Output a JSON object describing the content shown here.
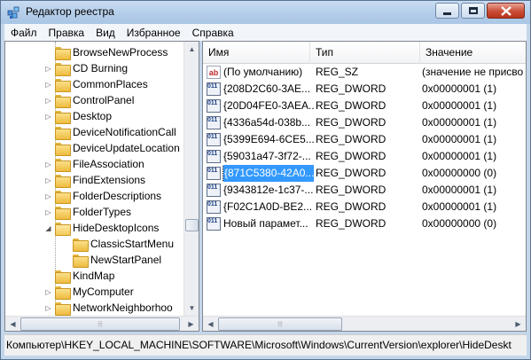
{
  "window": {
    "title": "Редактор реестра"
  },
  "menu": [
    "Файл",
    "Правка",
    "Вид",
    "Избранное",
    "Справка"
  ],
  "tree": {
    "items": [
      {
        "label": "BrowseNewProcess",
        "expandable": false,
        "level": 1
      },
      {
        "label": "CD Burning",
        "expandable": true,
        "level": 1
      },
      {
        "label": "CommonPlaces",
        "expandable": true,
        "level": 1
      },
      {
        "label": "ControlPanel",
        "expandable": true,
        "level": 1
      },
      {
        "label": "Desktop",
        "expandable": true,
        "level": 1
      },
      {
        "label": "DeviceNotificationCall",
        "expandable": false,
        "level": 1
      },
      {
        "label": "DeviceUpdateLocation",
        "expandable": false,
        "level": 1
      },
      {
        "label": "FileAssociation",
        "expandable": true,
        "level": 1
      },
      {
        "label": "FindExtensions",
        "expandable": true,
        "level": 1
      },
      {
        "label": "FolderDescriptions",
        "expandable": true,
        "level": 1
      },
      {
        "label": "FolderTypes",
        "expandable": true,
        "level": 1
      },
      {
        "label": "HideDesktopIcons",
        "expandable": true,
        "expanded": true,
        "level": 1
      },
      {
        "label": "ClassicStartMenu",
        "expandable": false,
        "level": 2
      },
      {
        "label": "NewStartPanel",
        "expandable": false,
        "level": 2
      },
      {
        "label": "KindMap",
        "expandable": false,
        "level": 1
      },
      {
        "label": "MyComputer",
        "expandable": true,
        "level": 1
      },
      {
        "label": "NetworkNeighborhoo",
        "expandable": true,
        "level": 1
      }
    ]
  },
  "list": {
    "columns": {
      "name": "Имя",
      "type": "Тип",
      "data": "Значение"
    },
    "rows": [
      {
        "name": "(По умолчанию)",
        "type": "REG_SZ",
        "data": "(значение не присво",
        "icon": "string-value-icon",
        "glyph": "ab"
      },
      {
        "name": "{208D2C60-3AE...",
        "type": "REG_DWORD",
        "data": "0x00000001 (1)",
        "icon": "dword-value-icon",
        "glyph": "011 110"
      },
      {
        "name": "{20D04FE0-3AEA...",
        "type": "REG_DWORD",
        "data": "0x00000001 (1)",
        "icon": "dword-value-icon",
        "glyph": "011 110"
      },
      {
        "name": "{4336a54d-038b...",
        "type": "REG_DWORD",
        "data": "0x00000001 (1)",
        "icon": "dword-value-icon",
        "glyph": "011 110"
      },
      {
        "name": "{5399E694-6CE5...",
        "type": "REG_DWORD",
        "data": "0x00000001 (1)",
        "icon": "dword-value-icon",
        "glyph": "011 110"
      },
      {
        "name": "{59031a47-3f72-...",
        "type": "REG_DWORD",
        "data": "0x00000001 (1)",
        "icon": "dword-value-icon",
        "glyph": "011 110"
      },
      {
        "name": "{871C5380-42A0...",
        "type": "REG_DWORD",
        "data": "0x00000000 (0)",
        "icon": "dword-value-icon",
        "glyph": "011 110",
        "selected": true
      },
      {
        "name": "{9343812e-1c37-...",
        "type": "REG_DWORD",
        "data": "0x00000001 (1)",
        "icon": "dword-value-icon",
        "glyph": "011 110"
      },
      {
        "name": "{F02C1A0D-BE2...",
        "type": "REG_DWORD",
        "data": "0x00000001 (1)",
        "icon": "dword-value-icon",
        "glyph": "011 110"
      },
      {
        "name": "Новый парамет...",
        "type": "REG_DWORD",
        "data": "0x00000000 (0)",
        "icon": "dword-value-icon",
        "glyph": "011 110"
      }
    ]
  },
  "status": {
    "path": "Компьютер\\HKEY_LOCAL_MACHINE\\SOFTWARE\\Microsoft\\Windows\\CurrentVersion\\explorer\\HideDeskt"
  },
  "icons": {
    "expand": "▷",
    "expanded": "◢",
    "arrow_up": "▲",
    "arrow_down": "▼",
    "arrow_left": "◀",
    "arrow_right": "▶",
    "grip": "⦙⦙⦙"
  },
  "colors": {
    "selection": "#3399ff",
    "titlebar": "#b9d1ea",
    "close_button": "#c94d36"
  }
}
